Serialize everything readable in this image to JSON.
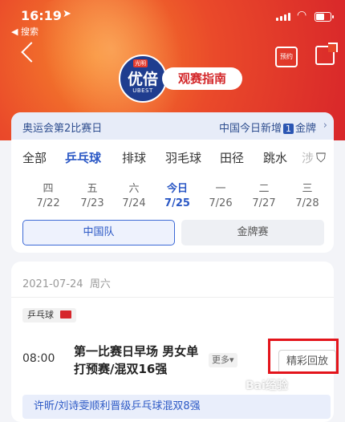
{
  "status_bar": {
    "time": "16:19",
    "back_label": "◀ 搜索"
  },
  "header": {
    "logo_top": "光明",
    "logo_main": "优倍",
    "logo_sub": "UBEST",
    "guide_label": "观赛指南",
    "reserve_label": "预约"
  },
  "info_bar": {
    "left": "奥运会第2比赛日",
    "right_prefix": "中国今日新增",
    "right_count": "1",
    "right_suffix": "金牌"
  },
  "sports_tabs": [
    "全部",
    "乒乓球",
    "排球",
    "羽毛球",
    "田径",
    "跳水",
    "涉"
  ],
  "active_sport": "乒乓球",
  "days": [
    {
      "weekday": "四",
      "date": "7/22"
    },
    {
      "weekday": "五",
      "date": "7/23"
    },
    {
      "weekday": "六",
      "date": "7/24"
    },
    {
      "weekday": "今日",
      "date": "7/25"
    },
    {
      "weekday": "一",
      "date": "7/26"
    },
    {
      "weekday": "二",
      "date": "7/27"
    },
    {
      "weekday": "三",
      "date": "7/28"
    }
  ],
  "segments": {
    "left": "中国队",
    "right": "金牌赛"
  },
  "card": {
    "date": "2021-07-24",
    "weekday": "周六",
    "sport_chip": "乒乓球",
    "event_time": "08:00",
    "event_title": "第一比赛日早场 男女单打预赛/混双16强",
    "more_label": "更多▾",
    "replay_label": "精彩回放",
    "banner": "许昕/刘诗雯顺利晋级乒乓球混双8强"
  },
  "watermark": "Bai经验"
}
